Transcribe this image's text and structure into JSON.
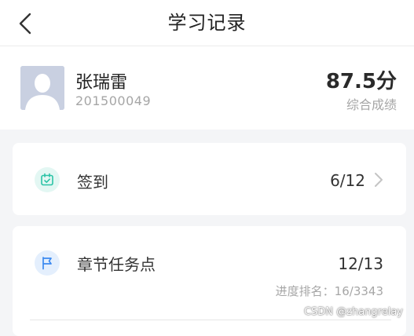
{
  "header": {
    "title": "学习记录",
    "back_icon": "chevron-left-icon"
  },
  "profile": {
    "name": "张瑞雷",
    "student_id": "201500049",
    "score": "87.5分",
    "score_label": "综合成绩",
    "avatar_icon": "user-silhouette-icon"
  },
  "signin": {
    "label": "签到",
    "value": "6/12",
    "icon": "calendar-check-icon",
    "icon_color": "#2bc3a6",
    "chevron_icon": "chevron-right-icon"
  },
  "chapter_tasks": {
    "label": "章节任务点",
    "value": "12/13",
    "rank": "进度排名：16/3343",
    "icon": "flag-icon",
    "icon_color": "#3b8af0"
  },
  "watermark": "CSDN @zhangrelay",
  "colors": {
    "page_bg": "#f4f5f7",
    "card_bg": "#ffffff",
    "text_primary": "#222222",
    "text_secondary": "#a6a6a6"
  }
}
